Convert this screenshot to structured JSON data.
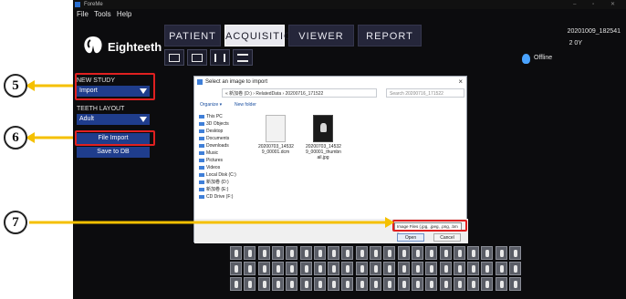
{
  "window": {
    "title": "ForeMe",
    "controls": "‒ ▫ ✕"
  },
  "menu": [
    "File",
    "Tools",
    "Help"
  ],
  "brand": {
    "name": "Eighteeth",
    "icon": "eighteeth-logo"
  },
  "nav": {
    "tabs": [
      "PATIENT",
      "ACQUISITION",
      "VIEWER",
      "REPORT"
    ],
    "active": "ACQUISITION"
  },
  "toolbar_icons": [
    "import-image-icon",
    "scan-image-icon",
    "columns-icon",
    "list-icon"
  ],
  "status": {
    "session_id": "20201009_182541",
    "age": "2 0Y",
    "connection": "Offline",
    "icon": "bulb-icon"
  },
  "sidebar": {
    "new_study_label": "NEW STUDY",
    "new_study_value": "Import",
    "teeth_layout_label": "TEETH LAYOUT",
    "teeth_layout_value": "Adult",
    "file_import_label": "File Import",
    "save_to_db_label": "Save to DB"
  },
  "callouts": [
    "5",
    "6",
    "7"
  ],
  "annotation_color": "#e02020",
  "arrow_color": "#f5c000",
  "dialog": {
    "title": "Select an image to import",
    "close": "×",
    "address": "« 新加卷 (D:) › RelatedData › 20200716_171522",
    "search_placeholder": "Search 20200716_171522",
    "organize": "Organize ▾",
    "new_folder": "New folder",
    "tree": [
      "This PC",
      "3D Objects",
      "Desktop",
      "Documents",
      "Downloads",
      "Music",
      "Pictures",
      "Videos",
      "Local Disk (C:)",
      "新加卷 (D:)",
      "新加卷 (E:)",
      "CD Drive (F:)"
    ],
    "files": [
      {
        "name": "20200703_14532 9_00001.dcm",
        "kind": "document"
      },
      {
        "name": "20200703_14532 9_00001_thumbn ail.jpg",
        "kind": "image"
      }
    ],
    "file_type": "Image Files (.jpg, .jpeg, .png, .bm ▾",
    "open_label": "Open",
    "cancel_label": "Cancel"
  }
}
